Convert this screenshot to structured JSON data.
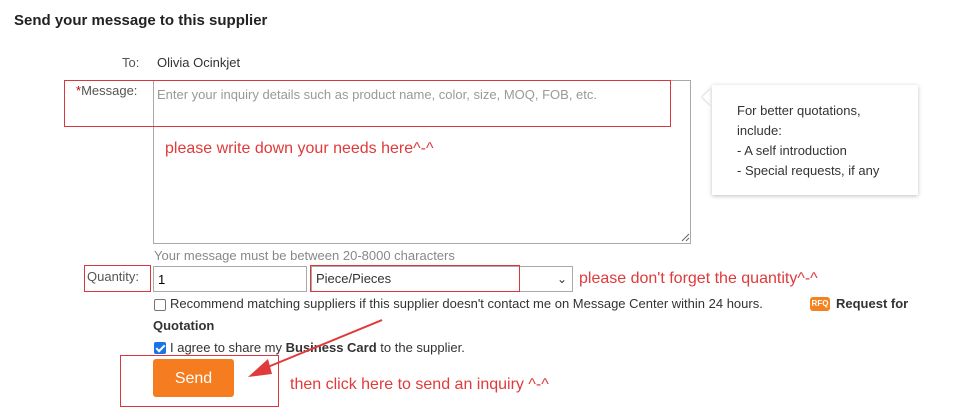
{
  "header": {
    "title": "Send your message to this supplier"
  },
  "form": {
    "to_label": "To:",
    "to_value": "Olivia Ocinkjet",
    "message_required_mark": "*",
    "message_label": "Message:",
    "message_placeholder": "Enter your inquiry details such as product name, color, size, MOQ, FOB, etc.",
    "message_hint": "Your message must be between 20-8000 characters",
    "quantity_label": "Quantity:",
    "quantity_value": "1",
    "unit_selected": "Piece/Pieces",
    "recommend_text": "Recommend matching suppliers if this supplier doesn't contact me on Message Center within 24 hours.",
    "recommend_checked": false,
    "rfq_badge": "RFQ",
    "rfq_text_1": "Request for",
    "rfq_text_2": "Quotation",
    "agree_prefix": "I agree to share my ",
    "agree_bold": "Business Card",
    "agree_suffix": " to the supplier.",
    "agree_checked": true,
    "send_label": "Send"
  },
  "tip": {
    "line1": "For better quotations,",
    "line2": "include:",
    "line3": "- A self introduction",
    "line4": "- Special requests, if any"
  },
  "annotations": {
    "message_note": "please write down your needs here^-^",
    "quantity_note": "please don't forget the quantity^-^",
    "send_note": "then click here to send an inquiry ^-^",
    "color": "#e03a3a"
  },
  "colors": {
    "send_button": "#f57c1f",
    "checkbox_on": "#1a73e8"
  }
}
